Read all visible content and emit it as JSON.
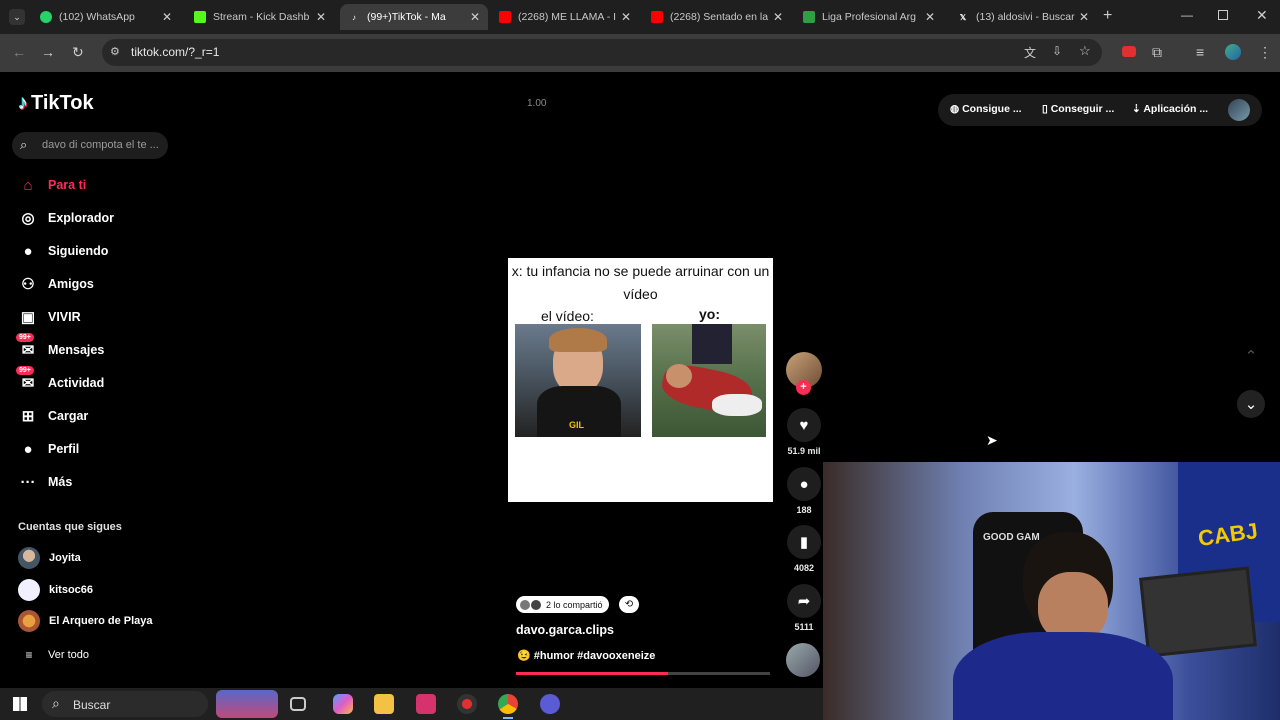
{
  "browser": {
    "tabs": [
      {
        "title": "(102) WhatsApp",
        "favicon": "whatsapp-icon",
        "color": "#25d366"
      },
      {
        "title": "Stream - Kick Dashb",
        "favicon": "kick-icon",
        "color": "#53fc18"
      },
      {
        "title": "(99+)TikTok - Ma",
        "favicon": "tiktok-icon",
        "color": "#ffffff"
      },
      {
        "title": "(2268) ME LLAMA - I",
        "favicon": "youtube-icon",
        "color": "#ff0000"
      },
      {
        "title": "(2268) Sentado en la",
        "favicon": "youtube-icon",
        "color": "#ff0000"
      },
      {
        "title": "Liga Profesional Arg",
        "favicon": "liga-icon",
        "color": "#2ea043"
      },
      {
        "title": "(13) aldosivi - Buscar",
        "favicon": "x-icon",
        "color": "#ffffff"
      }
    ],
    "url": "tiktok.com/?_r=1"
  },
  "tiktok": {
    "logo": "TikTok",
    "search_placeholder": "davo di compota el te ...",
    "nav": [
      {
        "label": "Para ti",
        "icon": "home-icon",
        "glyph": "⌂"
      },
      {
        "label": "Explorador",
        "icon": "compass-icon",
        "glyph": "◎"
      },
      {
        "label": "Siguiendo",
        "icon": "following-avatar-icon",
        "glyph": "●"
      },
      {
        "label": "Amigos",
        "icon": "friends-icon",
        "glyph": "⚇"
      },
      {
        "label": "VIVIR",
        "icon": "live-icon",
        "glyph": "▣"
      },
      {
        "label": "Mensajes",
        "icon": "messages-icon",
        "glyph": "✉",
        "badge": "99+"
      },
      {
        "label": "Actividad",
        "icon": "activity-icon",
        "glyph": "✉",
        "badge": "99+"
      },
      {
        "label": "Cargar",
        "icon": "upload-icon",
        "glyph": "⊞"
      },
      {
        "label": "Perfil",
        "icon": "profile-icon",
        "glyph": "●"
      },
      {
        "label": "Más",
        "icon": "more-icon",
        "glyph": "···"
      }
    ],
    "following_title": "Cuentas que sigues",
    "following": [
      "Joyita",
      "kitsoc66",
      "El Arquero de Playa"
    ],
    "see_all": "Ver todo",
    "speed": "1.00",
    "top_buttons": [
      "Consigue ...",
      "Conseguir ...",
      "Aplicación ..."
    ],
    "video": {
      "caption": "x: tu infancia no se puede arruinar con un vídeo",
      "label_left": "el vídeo:",
      "label_right": "yo:",
      "image_left_text": "GIL"
    },
    "actions": {
      "likes": "51.9 mil",
      "comments": "188",
      "saves": "4082",
      "shares": "5111"
    },
    "shared_text": "2 lo compartió",
    "username": "davo.garca.clips",
    "description": "😉 #humor #davooxeneize",
    "progress": 0.6,
    "accent": "#fe2c55"
  },
  "stream_overlay": {
    "chair_text": "GOOD GAM",
    "banner_text": "CABJ"
  },
  "taskbar": {
    "search": "Buscar"
  }
}
